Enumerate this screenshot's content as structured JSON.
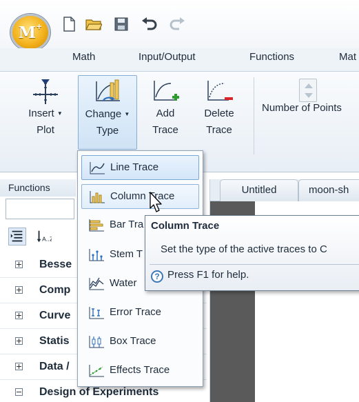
{
  "app": {
    "logo_text": "M",
    "logo_sup": "+"
  },
  "quick_access": [
    {
      "name": "new-document-icon"
    },
    {
      "name": "open-folder-icon"
    },
    {
      "name": "save-icon"
    },
    {
      "name": "undo-icon"
    },
    {
      "name": "redo-icon"
    }
  ],
  "menu_tabs": [
    "Math",
    "Input/Output",
    "Functions",
    "Mat"
  ],
  "ribbon": {
    "insert_plot": [
      "Insert",
      "Plot"
    ],
    "change_type": [
      "Change",
      "Type"
    ],
    "add_trace": [
      "Add",
      "Trace"
    ],
    "delete_trace": [
      "Delete",
      "Trace"
    ],
    "number_of_points": "Number of Points"
  },
  "functions_panel": {
    "title": "Functions",
    "search_value": "",
    "tree_items": [
      {
        "label": "Besse",
        "expanded": false
      },
      {
        "label": "Comp",
        "expanded": false
      },
      {
        "label": "Curve",
        "expanded": false
      },
      {
        "label": "Statis",
        "expanded": false
      },
      {
        "label": "Data /",
        "expanded": false
      },
      {
        "label": "Design of Experiments",
        "expanded": true
      }
    ]
  },
  "document_tabs": [
    "Untitled",
    "moon-sh"
  ],
  "trace_menu": {
    "items": [
      {
        "label": "Line Trace",
        "icon": "line-trace-icon"
      },
      {
        "label": "Column Trace",
        "icon": "column-trace-icon"
      },
      {
        "label": "Bar Tra",
        "icon": "bar-trace-icon"
      },
      {
        "label": "Stem T",
        "icon": "stem-trace-icon"
      },
      {
        "label": "Water",
        "icon": "waterfall-trace-icon"
      },
      {
        "label": "Error Trace",
        "icon": "error-trace-icon"
      },
      {
        "label": "Box Trace",
        "icon": "box-trace-icon"
      },
      {
        "label": "Effects Trace",
        "icon": "effects-trace-icon"
      }
    ],
    "selected": "Line Trace",
    "hovered": "Column Trace"
  },
  "tooltip": {
    "title": "Column Trace",
    "description": "Set the type of the active traces to C",
    "help": "Press F1 for help."
  },
  "colors": {
    "accent_gold": "#f3b21c",
    "ribbon_bg": "#e7eef5",
    "selection_blue": "#7aa6d3",
    "add_green": "#2f9a2f",
    "delete_red": "#d8262b"
  }
}
